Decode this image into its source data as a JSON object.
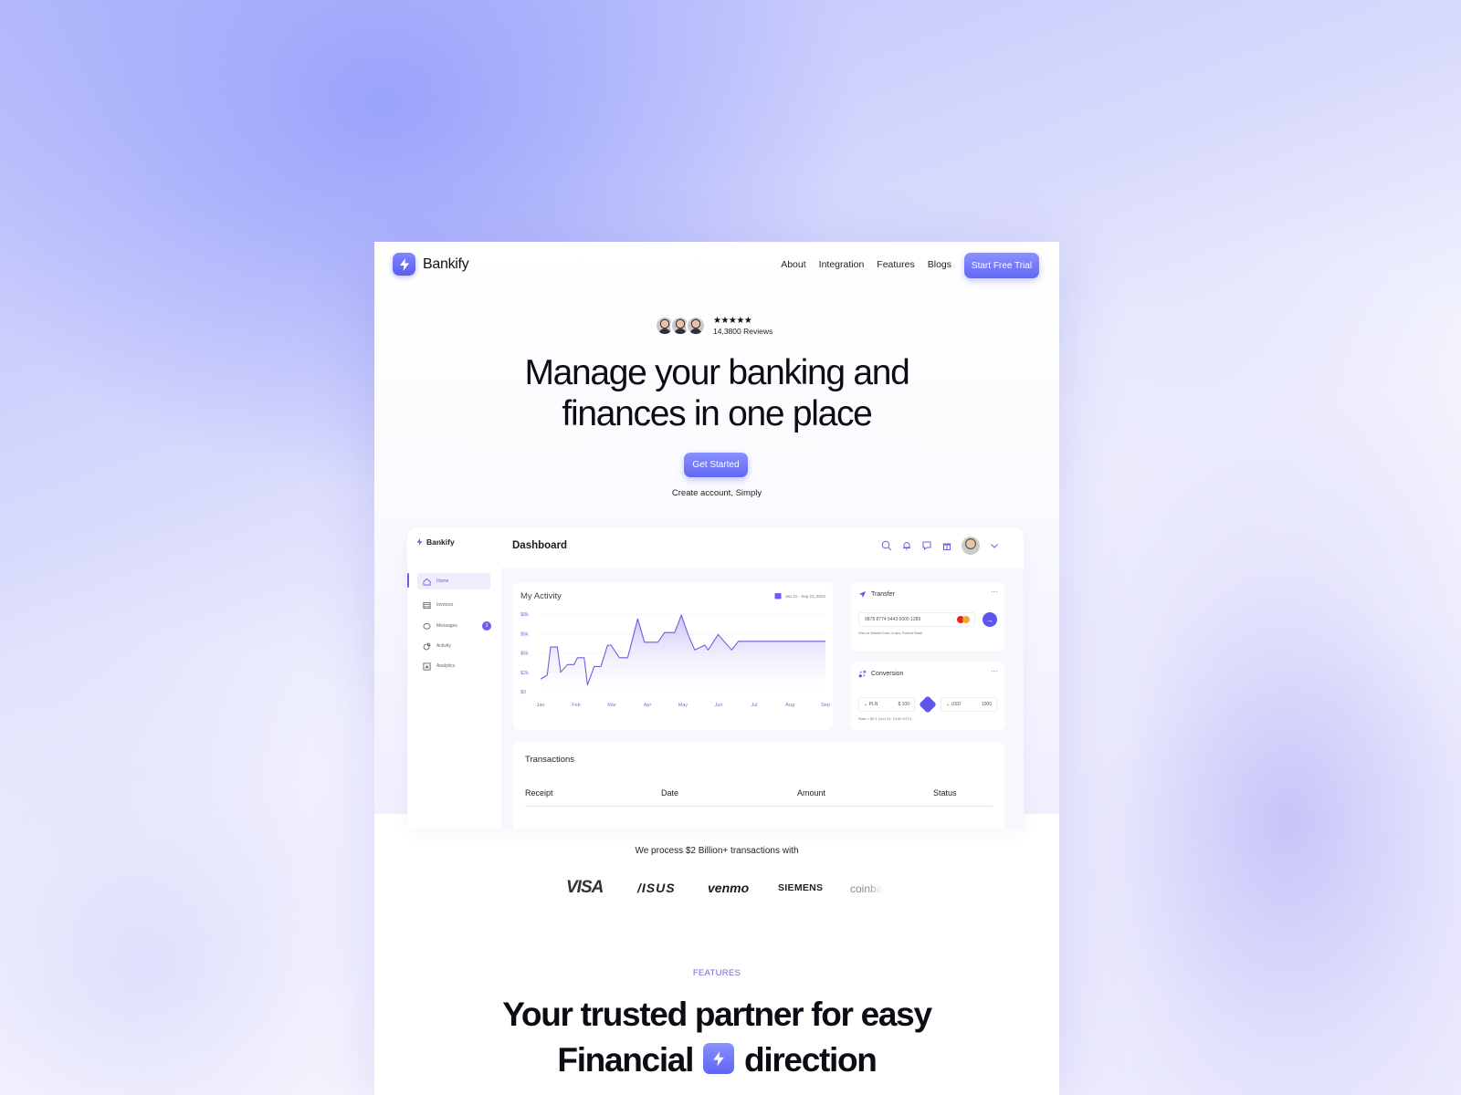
{
  "nav": {
    "brand": "Bankify",
    "links": [
      "About",
      "Integration",
      "Features",
      "Blogs"
    ],
    "cta": "Start Free Trial"
  },
  "hero": {
    "rating_stars": "★★★★★",
    "reviews": "14,3800 Reviews",
    "headline_line1": "Manage your banking and",
    "headline_line2": "finances in one place",
    "cta": "Get Started",
    "subtext": "Create account, Simply"
  },
  "dashboard": {
    "brand": "Bankify",
    "title": "Dashboard",
    "sidebar": [
      {
        "label": "Home",
        "icon": "home-icon",
        "active": true
      },
      {
        "label": "Invoices",
        "icon": "invoice-icon"
      },
      {
        "label": "Messages",
        "icon": "message-icon",
        "badge": "3"
      },
      {
        "label": "Activity",
        "icon": "activity-icon"
      },
      {
        "label": "Analytics",
        "icon": "analytics-icon"
      }
    ],
    "header_icons": [
      "search-icon",
      "bell-icon",
      "chat-icon",
      "gift-icon",
      "avatar",
      "chevron-down-icon"
    ],
    "activity": {
      "title": "My Activity",
      "date_range": "Jan 21 - Sep 21, 2022"
    },
    "transfer": {
      "title": "Transfer",
      "more": "···",
      "card_number": "9878 8774 5443 0000 1289",
      "hint": "Visa or MasterCard of any Poland Bank",
      "send": "→"
    },
    "conversion": {
      "title": "Conversion",
      "more": "···",
      "from_currency": "PLN",
      "from_amount": "$ 100",
      "to_currency": "USD",
      "to_amount": "1000",
      "rate": "Rate = $0.1 (Jun 21, 13:59 UTC)"
    },
    "transactions": {
      "title": "Transactions",
      "columns": [
        "Receipt",
        "Date",
        "Amount",
        "Status"
      ]
    }
  },
  "chart_data": {
    "type": "area",
    "title": "My Activity",
    "xlabel": "",
    "ylabel": "",
    "categories": [
      "Jan",
      "Feb",
      "Mar",
      "Apr",
      "May",
      "Jun",
      "Jul",
      "Aug",
      "Sep"
    ],
    "y_ticks": [
      "$0",
      "$2k",
      "$5k",
      "$6k",
      "$8k"
    ],
    "ylim": [
      0,
      8
    ],
    "grid": true,
    "x": [
      0,
      0.2,
      0.3,
      0.5,
      0.6,
      0.8,
      1.0,
      1.1,
      1.3,
      1.4,
      1.6,
      1.8,
      2.0,
      2.1,
      2.35,
      2.6,
      2.9,
      3.1,
      3.5,
      3.7,
      4.0,
      4.2,
      4.4,
      4.6,
      4.9,
      5.0,
      5.3,
      5.7,
      5.9,
      6.2,
      6.5,
      6.9,
      7.3,
      7.7,
      8.1,
      8.5
    ],
    "values": [
      1.3,
      1.7,
      4.6,
      4.6,
      2.0,
      2.8,
      2.8,
      3.5,
      3.5,
      0.7,
      2.6,
      2.6,
      4.8,
      4.8,
      3.5,
      3.5,
      7.5,
      5.1,
      5.1,
      6.1,
      6.1,
      7.9,
      5.9,
      4.3,
      4.8,
      4.3,
      5.9,
      4.3,
      5.2,
      5.2,
      5.2,
      5.2,
      5.2,
      5.2,
      5.2,
      5.2
    ],
    "series": [
      {
        "name": "Activity",
        "color": "#6b5fe0"
      }
    ]
  },
  "partners": {
    "text": "We process $2 Billion+ transactions with",
    "logos": [
      "VISA",
      "/ISUS",
      "venmo",
      "SIEMENS",
      "coinbase"
    ]
  },
  "features": {
    "label": "FEATURES",
    "title_line1": "Your trusted partner for easy",
    "title_line2a": "Financial",
    "title_line2b": "direction"
  },
  "colors": {
    "accent": "#6268f3",
    "accent_dark": "#5d55ee",
    "label": "#6f67d9"
  }
}
